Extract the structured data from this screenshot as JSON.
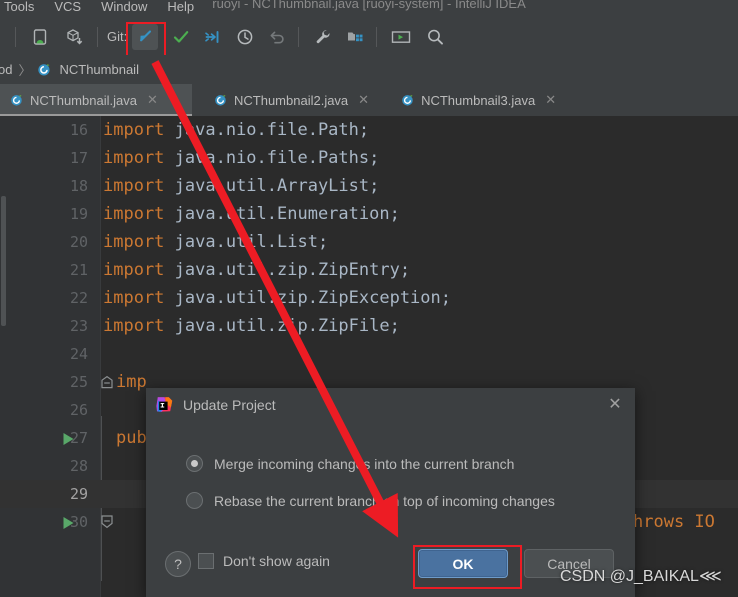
{
  "window": {
    "title": "ruoyi - NCThumbnail.java [ruoyi-system] - IntelliJ IDEA",
    "menu": [
      "Tools",
      "VCS",
      "Window",
      "Help"
    ]
  },
  "toolbar": {
    "git_label": "Git:",
    "icons": [
      {
        "name": "device-android-icon",
        "title": "Select Device"
      },
      {
        "name": "package-download-icon",
        "title": "Sync Project"
      },
      {
        "name": "git-update-icon",
        "title": "Update Project"
      },
      {
        "name": "git-commit-check-icon",
        "title": "Commit"
      },
      {
        "name": "git-push-icon",
        "title": "Push"
      },
      {
        "name": "history-clock-icon",
        "title": "History"
      },
      {
        "name": "revert-undo-icon",
        "title": "Rollback"
      },
      {
        "name": "wrench-settings-icon",
        "title": "Settings"
      },
      {
        "name": "project-structure-icon",
        "title": "Project Structure"
      },
      {
        "name": "run-configuration-icon",
        "title": "Run"
      },
      {
        "name": "search-icon",
        "title": "Search Everywhere"
      }
    ]
  },
  "breadcrumb": {
    "prefix": "od",
    "separator": "〉",
    "class_name": "NCThumbnail"
  },
  "tabs": [
    {
      "label": "NCThumbnail.java",
      "active": true
    },
    {
      "label": "NCThumbnail2.java",
      "active": false
    },
    {
      "label": "NCThumbnail3.java",
      "active": false
    }
  ],
  "editor": {
    "lines": [
      {
        "num": "16",
        "keyword": "import",
        "rest": " java.nio.file.Path;"
      },
      {
        "num": "17",
        "keyword": "import",
        "rest": " java.nio.file.Paths;"
      },
      {
        "num": "18",
        "keyword": "import",
        "rest": " java.util.ArrayList;"
      },
      {
        "num": "19",
        "keyword": "import",
        "rest": " java.util.Enumeration;"
      },
      {
        "num": "20",
        "keyword": "import",
        "rest": " java.util.List;"
      },
      {
        "num": "21",
        "keyword": "import",
        "rest": " java.util.zip.ZipEntry;"
      },
      {
        "num": "22",
        "keyword": "import",
        "rest": " java.util.zip.ZipException;"
      },
      {
        "num": "23",
        "keyword": "import",
        "rest": " java.util.zip.ZipFile;"
      },
      {
        "num": "24",
        "keyword": "",
        "rest": ""
      },
      {
        "num": "25",
        "keyword": "imp",
        "rest": ""
      },
      {
        "num": "26",
        "keyword": "",
        "rest": ""
      },
      {
        "num": "27",
        "keyword": "pub",
        "rest": ""
      },
      {
        "num": "28",
        "keyword": "",
        "rest": ""
      },
      {
        "num": "29",
        "keyword": "",
        "rest": ""
      },
      {
        "num": "30",
        "keyword": "",
        "rest": ""
      }
    ],
    "line30_tail": "hrows IO",
    "current_line": "29"
  },
  "dialog": {
    "title": "Update Project",
    "close_label": "✕",
    "options": [
      {
        "label": "Merge incoming changes into the current branch",
        "selected": true
      },
      {
        "label": "Rebase the current branch on top of incoming changes",
        "selected": false
      }
    ],
    "help_label": "?",
    "dont_show_again": "Don't show again",
    "ok_label": "OK",
    "cancel_label": "Cancel"
  },
  "annotations": {
    "watermark": "CSDN @J_BAIKAL⋘",
    "highlight_color": "#ec1c24",
    "arrow_color": "#ed1c24"
  },
  "colors": {
    "toolbar_bg": "#3c3f41",
    "editor_bg": "#2b2b2b",
    "gutter_bg": "#313335",
    "keyword": "#cc7832",
    "identifier": "#a9b7c6",
    "accent_blue": "#4a72a0"
  }
}
